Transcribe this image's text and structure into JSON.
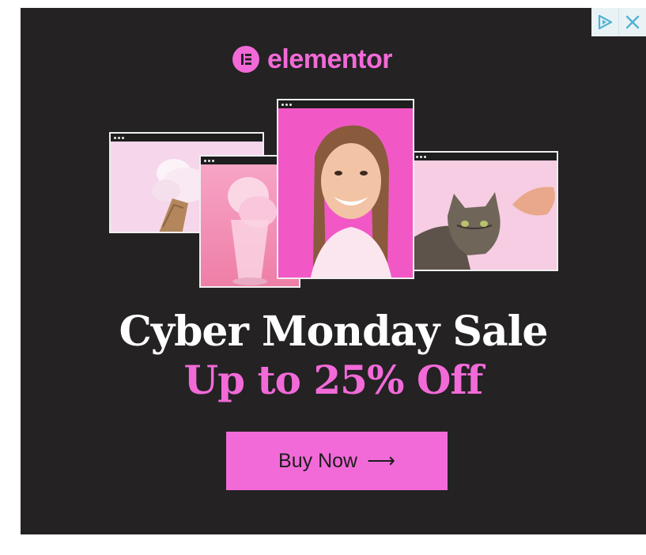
{
  "brand": {
    "logo_letter": "E",
    "name": "elementor"
  },
  "headline": {
    "line1": "Cyber Monday Sale",
    "line2": "Up to 25% Off"
  },
  "cta": {
    "label": "Buy Now",
    "arrow": "⟶"
  },
  "adchoices": {
    "info_icon": "adchoices-triangle-icon",
    "close_icon": "close-icon"
  },
  "colors": {
    "background": "#242223",
    "accent_pink": "#f26ad8",
    "headline_white": "#ffffff",
    "button_text": "#1d1d1d",
    "adchoices_blue": "#4fb3d4"
  },
  "preview_windows": [
    {
      "subject": "pink ice cream photo"
    },
    {
      "subject": "pink milkshake photo"
    },
    {
      "subject": "smiling woman portrait"
    },
    {
      "subject": "tabby cat with fist bump"
    }
  ]
}
